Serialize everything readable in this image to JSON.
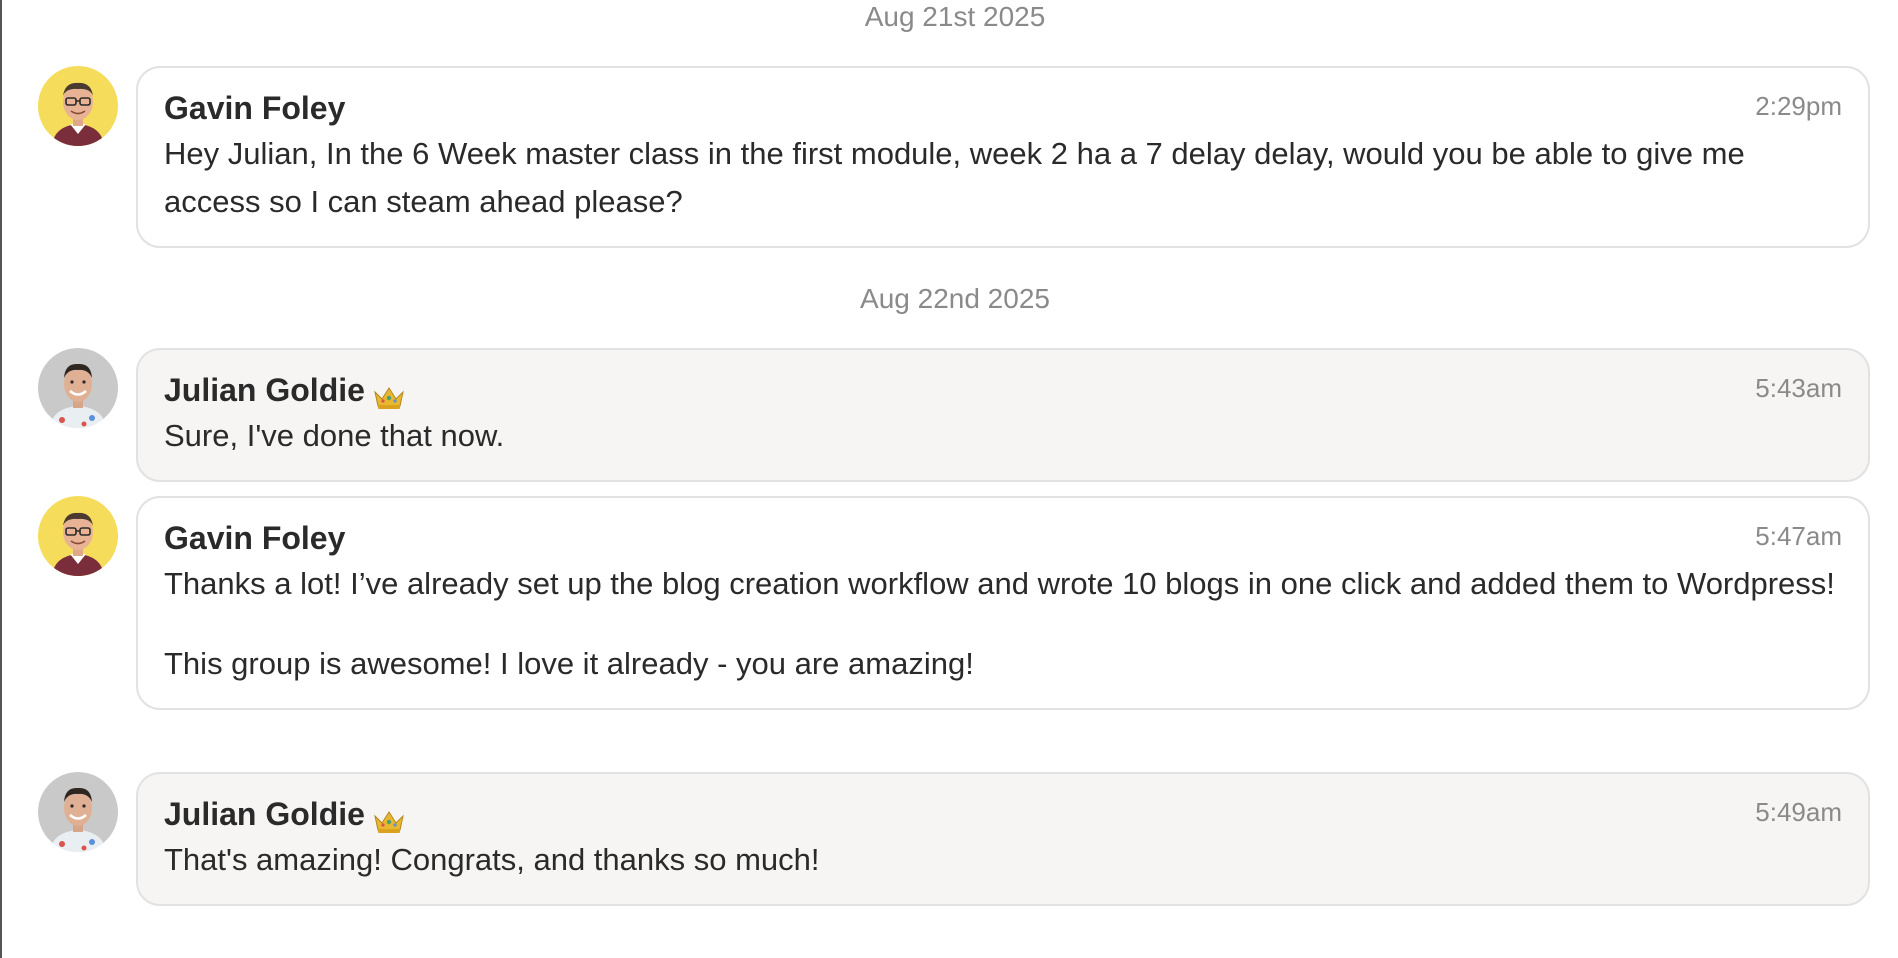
{
  "thread": {
    "groups": [
      {
        "date": "Aug 21st 2025",
        "messages": [
          {
            "author": "Gavin Foley",
            "time": "2:29pm",
            "paragraphs": [
              "Hey Julian, In the 6 Week master class in the first module, week 2 ha a 7 delay delay, would you be able to give me access so I can steam ahead please?"
            ]
          }
        ]
      },
      {
        "date": "Aug 22nd 2025",
        "messages": [
          {
            "author": "Julian Goldie",
            "time": "5:43am",
            "paragraphs": [
              "Sure, I've done that now."
            ]
          },
          {
            "author": "Gavin Foley",
            "time": "5:47am",
            "paragraphs": [
              "Thanks a lot! I’ve already set up the blog creation workflow and wrote 10 blogs in one click and added them to Wordpress!",
              "This group is awesome! I love it already - you are amazing!"
            ]
          },
          {
            "author": "Julian Goldie",
            "time": "5:49am",
            "paragraphs": [
              "That's amazing! Congrats, and thanks so much!"
            ]
          }
        ]
      }
    ]
  },
  "colors": {
    "gavin_avatar_bg": "#f6dc5b",
    "julian_avatar_bg": "#c9c9c9",
    "grey_bubble": "#f6f5f3",
    "white_bubble": "#ffffff",
    "muted_text": "#8a8a8a"
  },
  "icons": {
    "admin_badge": "crown-icon"
  }
}
